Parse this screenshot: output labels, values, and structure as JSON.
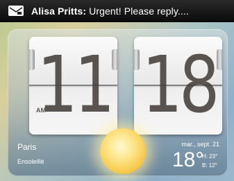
{
  "statusbar": {
    "icon": "mail-icon",
    "sender": "Alisa Pritts:",
    "message": "Urgent! Please reply...."
  },
  "clock": {
    "hours": "11",
    "minutes": "18",
    "ampm": "AM"
  },
  "weather": {
    "city": "Paris",
    "condition": "Ensoleillé",
    "date": "mar., sept. 21",
    "temperature": "18°",
    "high": "H: 23°",
    "low": "B: 12°",
    "icon": "sun-icon"
  },
  "colors": {
    "statusbar": "#0b0b0b",
    "digit": "#5a5450",
    "sun": "#f7c84a"
  }
}
